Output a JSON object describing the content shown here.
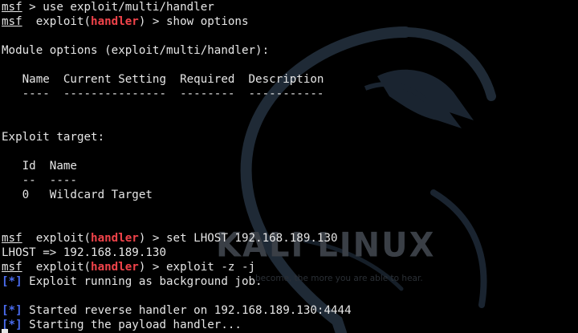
{
  "terminal": {
    "prompt": "msf",
    "module_name": "handler",
    "lines": [
      {
        "kind": "prompt-plain",
        "text": " > use exploit/multi/handler"
      },
      {
        "kind": "prompt-module",
        "pre": "  exploit(",
        "post": ") > show options"
      },
      {
        "kind": "text",
        "text": ""
      },
      {
        "kind": "text",
        "text": "Module options (exploit/multi/handler):"
      },
      {
        "kind": "text",
        "text": ""
      },
      {
        "kind": "text",
        "text": "   Name  Current Setting  Required  Description"
      },
      {
        "kind": "text",
        "text": "   ----  ---------------  --------  -----------"
      },
      {
        "kind": "text",
        "text": ""
      },
      {
        "kind": "text",
        "text": ""
      },
      {
        "kind": "text",
        "text": "Exploit target:"
      },
      {
        "kind": "text",
        "text": ""
      },
      {
        "kind": "text",
        "text": "   Id  Name"
      },
      {
        "kind": "text",
        "text": "   --  ----"
      },
      {
        "kind": "text",
        "text": "   0   Wildcard Target"
      },
      {
        "kind": "text",
        "text": ""
      },
      {
        "kind": "text",
        "text": ""
      },
      {
        "kind": "prompt-module",
        "pre": "  exploit(",
        "post": ") > set LHOST 192.168.189.130"
      },
      {
        "kind": "text",
        "text": "LHOST => 192.168.189.130"
      },
      {
        "kind": "prompt-module",
        "pre": "  exploit(",
        "post": ") > exploit -z -j"
      },
      {
        "kind": "status",
        "marker": "[*]",
        "text": " Exploit running as background job."
      },
      {
        "kind": "text",
        "text": ""
      },
      {
        "kind": "status",
        "marker": "[*]",
        "text": " Started reverse handler on 192.168.189.130:4444"
      },
      {
        "kind": "status",
        "marker": "[*]",
        "text": " Starting the payload handler..."
      }
    ]
  },
  "wallpaper": {
    "brand": "KALI LINUX",
    "tagline": "become, the more you are able to hear."
  },
  "colors": {
    "background": "#000000",
    "text": "#e6e6e6",
    "module_highlight": "#f0434a",
    "status_marker": "#4a6cf0",
    "watermark": "#3a3f46"
  },
  "icons": {
    "background_logo": "kali-dragon-icon"
  }
}
